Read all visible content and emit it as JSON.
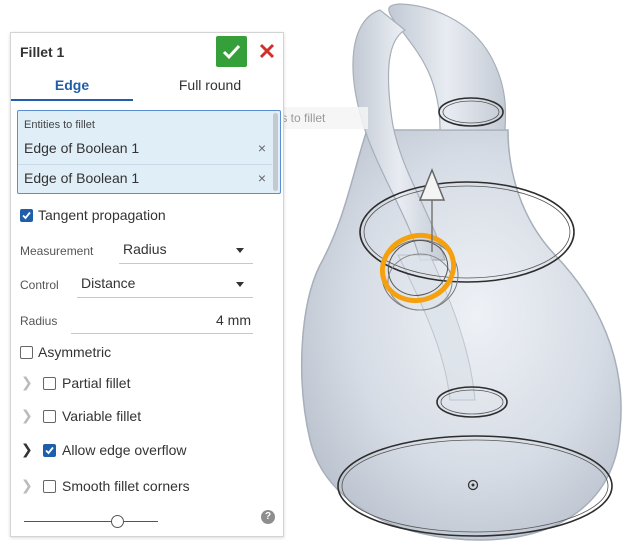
{
  "panel": {
    "title": "Fillet 1",
    "tabs": [
      {
        "label": "Edge"
      },
      {
        "label": "Full round"
      }
    ],
    "entities": {
      "label": "Entities to fillet",
      "items": [
        {
          "name": "Edge of Boolean 1",
          "remove": "×"
        },
        {
          "name": "Edge of Boolean 1",
          "remove": "×"
        }
      ]
    },
    "tangent_propagation": {
      "label": "Tangent propagation",
      "checked": true
    },
    "measurement": {
      "label": "Measurement",
      "value": "Radius"
    },
    "control": {
      "label": "Control",
      "value": "Distance"
    },
    "radius": {
      "label": "Radius",
      "value": "4 mm"
    },
    "asymmetric": {
      "label": "Asymmetric",
      "checked": false
    },
    "partial_fillet": {
      "label": "Partial fillet",
      "checked": false
    },
    "variable_fillet": {
      "label": "Variable fillet",
      "checked": false
    },
    "allow_edge_overflow": {
      "label": "Allow edge overflow",
      "checked": true
    },
    "smooth_fillet_corners": {
      "label": "Smooth fillet corners",
      "checked": false
    },
    "help": "?",
    "slider_fraction": 0.65
  },
  "tooltip": {
    "text": "Entities to fillet"
  },
  "colors": {
    "accent": "#1f5faa",
    "ok": "#35a03a",
    "cancel": "#d0302a",
    "selection": "#f5a10f",
    "entity_bg": "#e0eef8"
  }
}
